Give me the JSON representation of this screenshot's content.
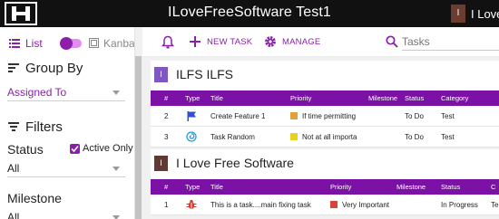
{
  "app": {
    "title": "ILoveFreeSoftware Test1",
    "user_initial": "I",
    "user_name": "I Love"
  },
  "sidebar": {
    "view": {
      "list_label": "List",
      "kanban_label": "Kanban"
    },
    "group_by": {
      "heading": "Group By",
      "value": "Assigned To"
    },
    "filters": {
      "heading": "Filters",
      "status_label": "Status",
      "active_only_label": "Active Only",
      "status_value": "All",
      "milestone_label": "Milestone",
      "milestone_value": "All"
    }
  },
  "toolbar": {
    "new_task_label": "NEW TASK",
    "manage_label": "MANAGE",
    "search_placeholder": "Tasks"
  },
  "groups": [
    {
      "badge": "I",
      "badge_color": "#7e57c2",
      "name": "ILFS ILFS",
      "columns": {
        "num": "#",
        "type": "Type",
        "title": "Title",
        "priority": "Priority",
        "milestone": "Milestone",
        "status": "Status",
        "category": "Category"
      },
      "rows": [
        {
          "num": "2",
          "type_icon": "flag-icon",
          "title": "Create Feature 1",
          "priority": "If time permitting",
          "priority_color": "#e0a33a",
          "milestone": "",
          "status": "To Do",
          "category": "Test"
        },
        {
          "num": "3",
          "type_icon": "swirl-icon",
          "title": "Task Random",
          "priority": "Not at all importa",
          "priority_color": "#e6d21f",
          "milestone": "",
          "status": "To Do",
          "category": "Test"
        }
      ]
    },
    {
      "badge": "I",
      "badge_color": "#5d3a33",
      "name": "I Love Free Software",
      "columns": {
        "num": "#",
        "type": "Type",
        "title": "Title",
        "priority": "Priority",
        "milestone": "Milestone",
        "status": "Status",
        "category": "C"
      },
      "rows": [
        {
          "num": "1",
          "type_icon": "bug-icon",
          "title": "This is a task....main fixing task",
          "priority": "Very Important",
          "priority_color": "#d9453a",
          "milestone": "",
          "status": "In Progress",
          "category": "Te"
        }
      ]
    }
  ]
}
